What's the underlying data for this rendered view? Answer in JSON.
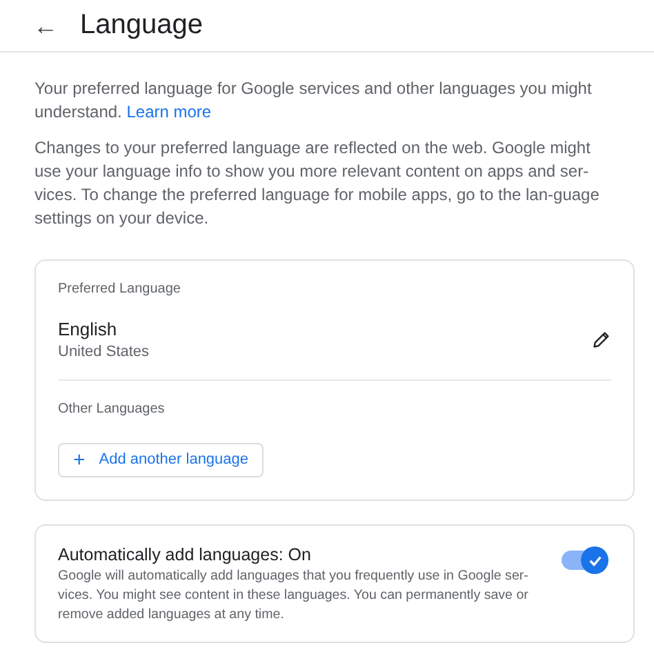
{
  "header": {
    "back_icon": "←",
    "title": "Language"
  },
  "intro": {
    "text": "Your preferred language for Google services and other languages you might understand.",
    "link": "Learn more"
  },
  "note": "Changes to your preferred language are reflected on the web. Google might use your language info to show you more relevant content on apps and ser-vices. To change the preferred language for mobile apps, go to the lan-guage settings on your device.",
  "languages_card": {
    "preferred_heading": "Preferred Language",
    "preferred": {
      "name": "English",
      "region": "United States"
    },
    "other_heading": "Other Languages",
    "add_button": {
      "icon": "+",
      "label": "Add another language"
    }
  },
  "auto_add": {
    "title": "Automatically add languages: On",
    "description": "Google will automatically add languages that you frequently use in Google ser-vices. You might see content in these languages. You can permanently save or remove added languages at any time.",
    "on": true
  }
}
